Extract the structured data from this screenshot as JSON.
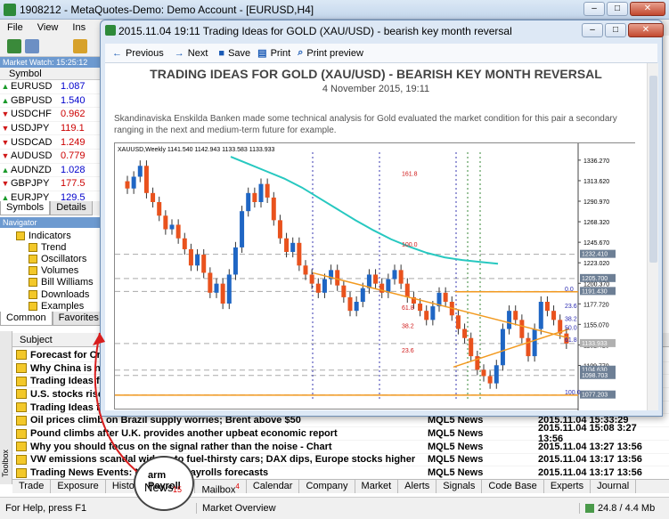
{
  "window": {
    "title": "1908212 - MetaQuotes-Demo: Demo Account - [EURUSD,H4]",
    "controls": [
      "–",
      "□",
      "✕"
    ]
  },
  "menu": [
    "File",
    "View",
    "Ins"
  ],
  "market_watch": {
    "header": "Market Watch: 15:25:12",
    "col": "Symbol",
    "rows": [
      {
        "sym": "EURUSD",
        "bid": "1.087",
        "dir": "up"
      },
      {
        "sym": "GBPUSD",
        "bid": "1.540",
        "dir": "up"
      },
      {
        "sym": "USDCHF",
        "bid": "0.962",
        "dir": "down"
      },
      {
        "sym": "USDJPY",
        "bid": "119.1",
        "dir": "down"
      },
      {
        "sym": "USDCAD",
        "bid": "1.249",
        "dir": "down"
      },
      {
        "sym": "AUDUSD",
        "bid": "0.779",
        "dir": "down"
      },
      {
        "sym": "AUDNZD",
        "bid": "1.028",
        "dir": "up"
      },
      {
        "sym": "GBPJPY",
        "bid": "177.5",
        "dir": "down"
      },
      {
        "sym": "EURJPY",
        "bid": "129.5",
        "dir": "up"
      }
    ],
    "tabs": [
      "Symbols",
      "Details"
    ]
  },
  "navigator": {
    "header": "Navigator",
    "items": [
      "Indicators",
      "Trend",
      "Oscillators",
      "Volumes",
      "Bill Williams",
      "Downloads",
      "Examples"
    ],
    "tabs": [
      "Common",
      "Favorites"
    ]
  },
  "toolbox": {
    "label": "Toolbox",
    "header": "Subject",
    "rows": [
      {
        "subject": "Forecast for Crude",
        "source": "",
        "time": ""
      },
      {
        "subject": "Why China is not F",
        "source": "",
        "time": ""
      },
      {
        "subject": "Trading Ideas for G",
        "source": "",
        "time": ""
      },
      {
        "subject": "U.S. stocks rise at",
        "source": "",
        "time": ""
      },
      {
        "subject": "Trading Ideas for E",
        "source": "",
        "time": ""
      },
      {
        "subject": "Oil prices climb on Brazil supply worries; Brent above $50",
        "source": "MQL5 News",
        "time": "2015.11.04 15:33:29"
      },
      {
        "subject": "Pound climbs after U.K. provides another upbeat economic report",
        "source": "MQL5 News",
        "time": "2015.11.04 15:08 3:27 13:56"
      },
      {
        "subject": "Why you should focus on the signal rather than the noise - Chart",
        "source": "MQL5 News",
        "time": "2015.11.04 13:27 13:56"
      },
      {
        "subject": "VW emissions scandal widens to fuel-thirsty cars; DAX dips, Europe stocks higher",
        "source": "MQL5 News",
        "time": "2015.11.04 13:17 13:56"
      },
      {
        "subject": "Trading News Events: Non-Farm Payrolls forecasts",
        "source": "MQL5 News",
        "time": "2015.11.04 13:17 13:56"
      }
    ],
    "tabs": [
      "Trade",
      "Exposure",
      "History",
      "News",
      "Mailbox",
      "Calendar",
      "Company",
      "Market",
      "Alerts",
      "Signals",
      "Code Base",
      "Experts",
      "Journal"
    ],
    "news_count": "15",
    "mailbox_count": "4"
  },
  "status": {
    "help": "For Help, press F1",
    "market": "Market Overview",
    "traffic": "24.8 / 4.4 Mb"
  },
  "dialog": {
    "title": "2015.11.04 19:11 Trading Ideas for GOLD (XAU/USD) - bearish key month reversal",
    "toolbar": {
      "previous": "Previous",
      "next": "Next",
      "save": "Save",
      "print": "Print",
      "print_preview": "Print preview"
    },
    "article": {
      "title": "TRADING IDEAS FOR GOLD (XAU/USD) - BEARISH KEY MONTH REVERSAL",
      "date": "4 November 2015, 19:11",
      "text": "Skandinaviska Enskilda Banken made some technical analysis for Gold evaluated the market condition for this pair a secondary ranging in the next and medium-term future for example."
    }
  },
  "callout": {
    "label": "arm Payroll",
    "tab": "News",
    "count": "15"
  },
  "chart_data": {
    "type": "candlestick",
    "title": "XAUUSD,Weekly  1141.540 1142.943 1133.583 1133.933",
    "ylim": [
      1070,
      1345
    ],
    "yticks": [
      "1336.270",
      "1313.620",
      "1290.970",
      "1268.320",
      "1245.670",
      "1223.020",
      "1200.370",
      "1177.720",
      "1155.070",
      "1132.420",
      "1109.770"
    ],
    "price_labels": [
      "1232.410",
      "1205.700",
      "1191.430",
      "1133.933",
      "1104.630",
      "1098.703",
      "1077.203"
    ],
    "fib_labels": [
      "161.8",
      "100.0",
      "61.8",
      "38.2",
      "23.6",
      "0.0",
      "23.6",
      "38.2",
      "50.0",
      "61.8",
      "100.0"
    ],
    "ma_points": [
      1340,
      1332,
      1324,
      1316,
      1306,
      1294,
      1282,
      1270,
      1259,
      1249,
      1241,
      1234,
      1229,
      1226,
      1224,
      1222
    ],
    "candles": [
      1305,
      1318,
      1330,
      1300,
      1290,
      1275,
      1260,
      1265,
      1250,
      1238,
      1220,
      1232,
      1212,
      1190,
      1200,
      1178,
      1210,
      1240,
      1280,
      1300,
      1290,
      1310,
      1295,
      1270,
      1250,
      1235,
      1245,
      1220,
      1210,
      1200,
      1190,
      1205,
      1215,
      1198,
      1185,
      1170,
      1180,
      1195,
      1210,
      1200,
      1190,
      1205,
      1215,
      1200,
      1185,
      1178,
      1170,
      1160,
      1175,
      1190,
      1180,
      1165,
      1150,
      1140,
      1120,
      1105,
      1098,
      1090,
      1110,
      1150,
      1170,
      1160,
      1140,
      1120,
      1150,
      1180,
      1170,
      1160,
      1145,
      1134
    ]
  }
}
